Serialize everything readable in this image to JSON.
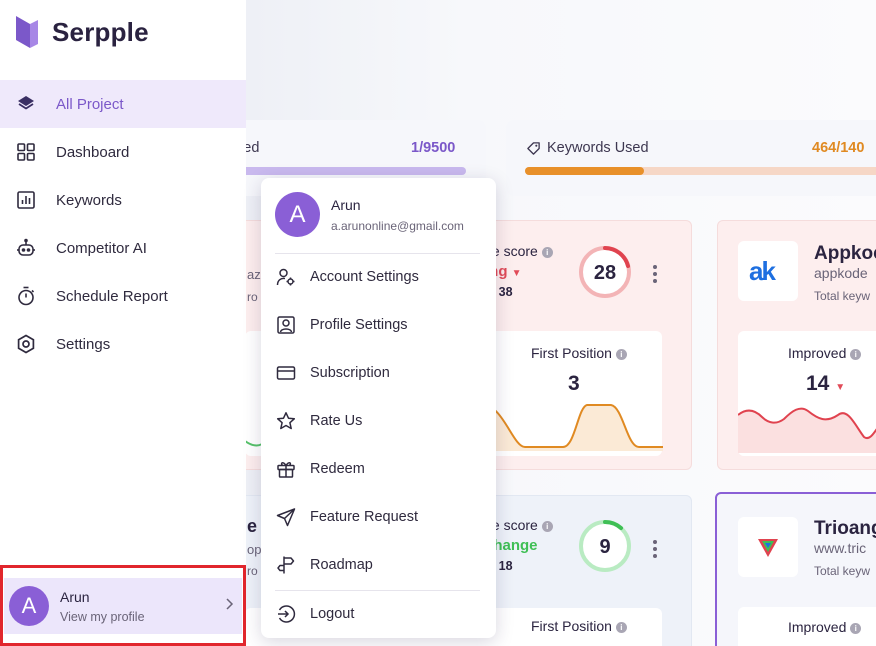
{
  "app": {
    "name": "Serpple"
  },
  "sidebar": {
    "items": [
      {
        "label": "All Project",
        "icon": "layers-icon",
        "active": true
      },
      {
        "label": "Dashboard",
        "icon": "grid-icon"
      },
      {
        "label": "Keywords",
        "icon": "bar-chart-icon"
      },
      {
        "label": "Competitor AI",
        "icon": "robot-icon"
      },
      {
        "label": "Schedule Report",
        "icon": "stopwatch-icon"
      },
      {
        "label": "Settings",
        "icon": "settings-icon"
      }
    ],
    "profile": {
      "initial": "A",
      "name": "Arun",
      "sub": "View my profile"
    }
  },
  "stats": {
    "projects": {
      "label_partial": "sed",
      "value": "1/9500",
      "fill": 0.0001,
      "color": "#8a5fd6"
    },
    "keywords": {
      "label": "Keywords Used",
      "value_partial": "464/140",
      "fill": 0.33,
      "color": "#e8902a"
    }
  },
  "cards": {
    "card1": {
      "score_label": "ple score",
      "status_partial": "ing",
      "total_partial": ": 38",
      "score": "28",
      "metric_label": "First Position",
      "metric_value": "3",
      "left_partial_1": "aze",
      "left_partial_2": "ro"
    },
    "card2": {
      "name_partial": "Appkoc",
      "url_partial": "appkode",
      "total_partial": "Total keyw",
      "metric_label": "Improved",
      "metric_value": "14"
    },
    "card3": {
      "score_label": "ple score",
      "status_partial": "change",
      "total_partial": ": 18",
      "score": "9",
      "metric_label": "First Position",
      "left_partial_1": "e",
      "left_partial_2": "op",
      "left_partial_3": "ro"
    },
    "card4": {
      "name_partial": "Trioang",
      "url_partial": "www.tric",
      "total_partial": "Total keyw",
      "metric_label": "Improved"
    }
  },
  "dropdown": {
    "user": {
      "initial": "A",
      "name": "Arun",
      "email": "a.arunonline@gmail.com"
    },
    "items": [
      {
        "label": "Account Settings",
        "icon": "user-cog-icon"
      },
      {
        "label": "Profile Settings",
        "icon": "id-card-icon"
      },
      {
        "label": "Subscription",
        "icon": "credit-card-icon"
      },
      {
        "label": "Rate Us",
        "icon": "star-icon"
      },
      {
        "label": "Redeem",
        "icon": "gift-icon"
      },
      {
        "label": "Feature Request",
        "icon": "send-icon"
      },
      {
        "label": "Roadmap",
        "icon": "signpost-icon"
      }
    ],
    "logout": {
      "label": "Logout",
      "icon": "logout-icon"
    }
  }
}
